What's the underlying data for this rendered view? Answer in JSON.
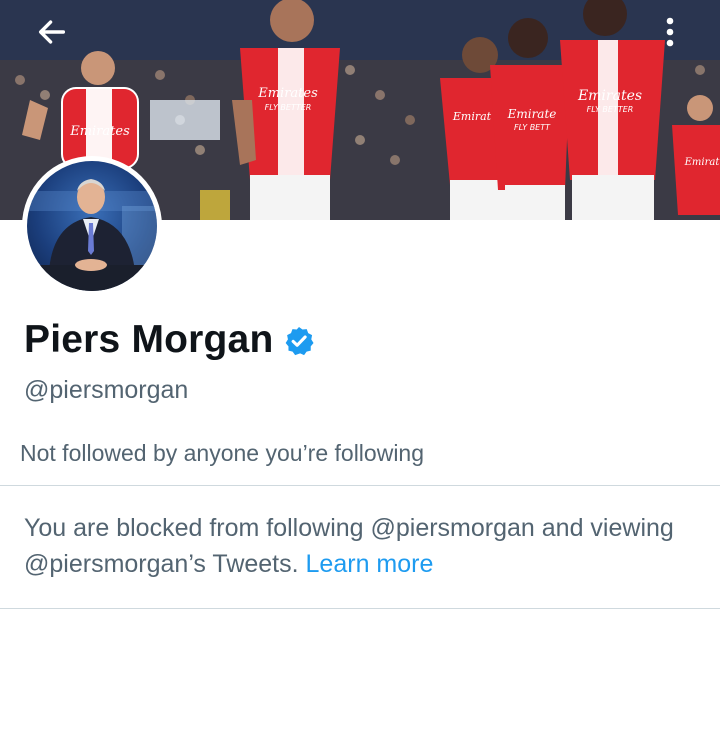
{
  "header": {
    "back_icon": "arrow-left-icon",
    "more_icon": "more-vertical-icon",
    "banner_sponsor_text": "Emirates",
    "banner_sponsor_tagline": "FLY BETTER"
  },
  "profile": {
    "display_name": "Piers Morgan",
    "verified_icon": "verified-badge-icon",
    "handle": "@piersmorgan",
    "followed_by": "Not followed by anyone you’re following"
  },
  "blocked": {
    "message": "You are blocked from following @piersmorgan and viewing @piersmorgan’s Tweets. ",
    "learn_more": "Learn more"
  },
  "colors": {
    "text_primary": "#0f1419",
    "text_secondary": "#536471",
    "link": "#1d9bf0",
    "verified": "#1d9bf0",
    "divider": "#cfd9de",
    "kit_red": "#e0262f"
  }
}
